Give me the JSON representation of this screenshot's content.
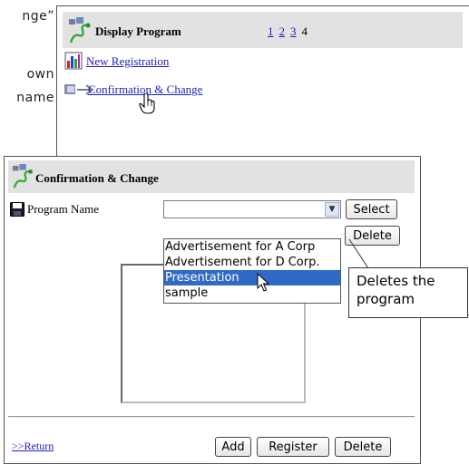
{
  "background_text": [
    "nge”",
    "own",
    "name"
  ],
  "top_window": {
    "title": "Display Program",
    "pages": [
      "1",
      "2",
      "3"
    ],
    "current_page": "4",
    "new_registration": "New Registration",
    "confirmation_link": "Confirmation & Change"
  },
  "dialog": {
    "title": "Confirmation & Change",
    "program_name_label": "Program Name",
    "selected_value": "",
    "select_button": "Select",
    "delete_button": "Delete",
    "options": [
      "Advertisement for A Corp",
      "Advertisement for D Corp.",
      "Presentation",
      "sample"
    ],
    "highlighted_option": "Presentation",
    "return_link": ">>Return",
    "add_button": "Add",
    "register_button": "Register",
    "bottom_delete_button": "Delete"
  },
  "callout": {
    "line1": "Deletes the",
    "line2": "program"
  },
  "icons": [
    "program-icon",
    "chart-icon",
    "link-arrow-icon",
    "save-disk-icon",
    "hand-cursor-icon",
    "arrow-cursor-icon",
    "dropdown-arrow-icon"
  ]
}
